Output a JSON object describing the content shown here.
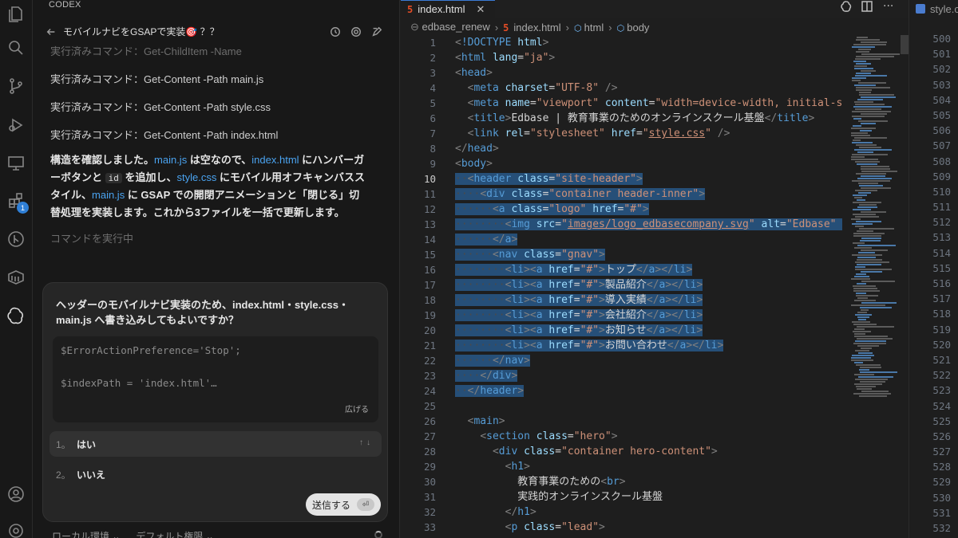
{
  "codex": {
    "title": "CODEX",
    "thread_title": "モバイルナビをGSAPで実装🎯 ？？",
    "commands": [
      "実行済みコマンド：Get-ChildItem -Name",
      "実行済みコマンド：Get-Content -Path main.js",
      "実行済みコマンド：Get-Content -Path style.css",
      "実行済みコマンド：Get-Content -Path index.html"
    ],
    "message": {
      "p1": "構造を確認しました。",
      "main_js": "main.js",
      "p2": " は空なので、",
      "index_html": "index.html",
      "p3": " にハンバーガーボタンと ",
      "id_code": "id",
      "p4": " を追加し、",
      "style_css": "style.css",
      "p5": " にモバイル用オフキャンバススタイル、",
      "main_js2": "main.js",
      "p6": " に GSAP での開閉アニメーションと「閉じる」切替処理を実装します。これから3ファイルを一括で更新します。"
    },
    "running": "コマンドを実行中",
    "approval": {
      "question": "ヘッダーのモバイルナビ実装のため、index.html・style.css・main.js へ書き込みしてもよいですか？",
      "code_line1": "$ErrorActionPreference='Stop';",
      "code_line2": "$indexPath = 'index.html'…",
      "expand": "広げる",
      "options": [
        {
          "num": "1。",
          "label": "はい"
        },
        {
          "num": "2。",
          "label": "いいえ"
        }
      ],
      "send": "送信する",
      "send_key": "⏎"
    },
    "footer": {
      "env": "ローカル環境 ⌄",
      "perm": "デフォルト権限 ⌄"
    }
  },
  "editor": {
    "tab": "index.html",
    "breadcrumb": [
      "edbase_renew",
      "index.html",
      "html",
      "body"
    ],
    "current_line": 10,
    "line_numbers": [
      1,
      2,
      3,
      4,
      5,
      6,
      7,
      8,
      9,
      10,
      11,
      12,
      13,
      14,
      15,
      16,
      17,
      18,
      19,
      20,
      21,
      22,
      23,
      24,
      25,
      26,
      27,
      28,
      29,
      30,
      31,
      32,
      33
    ]
  },
  "split2": {
    "tab": "style.css",
    "line_numbers": [
      500,
      501,
      502,
      503,
      504,
      505,
      506,
      507,
      508,
      509,
      510,
      511,
      512,
      513,
      514,
      515,
      516,
      517,
      518,
      519,
      520,
      521,
      522,
      523,
      524,
      525,
      526,
      527,
      528,
      529,
      530,
      531,
      532
    ]
  },
  "colors": {
    "tag": "#569cd6",
    "attr": "#9cdcfe",
    "string": "#ce9178",
    "selection": "#264f78",
    "link": "#4aa3f0"
  }
}
